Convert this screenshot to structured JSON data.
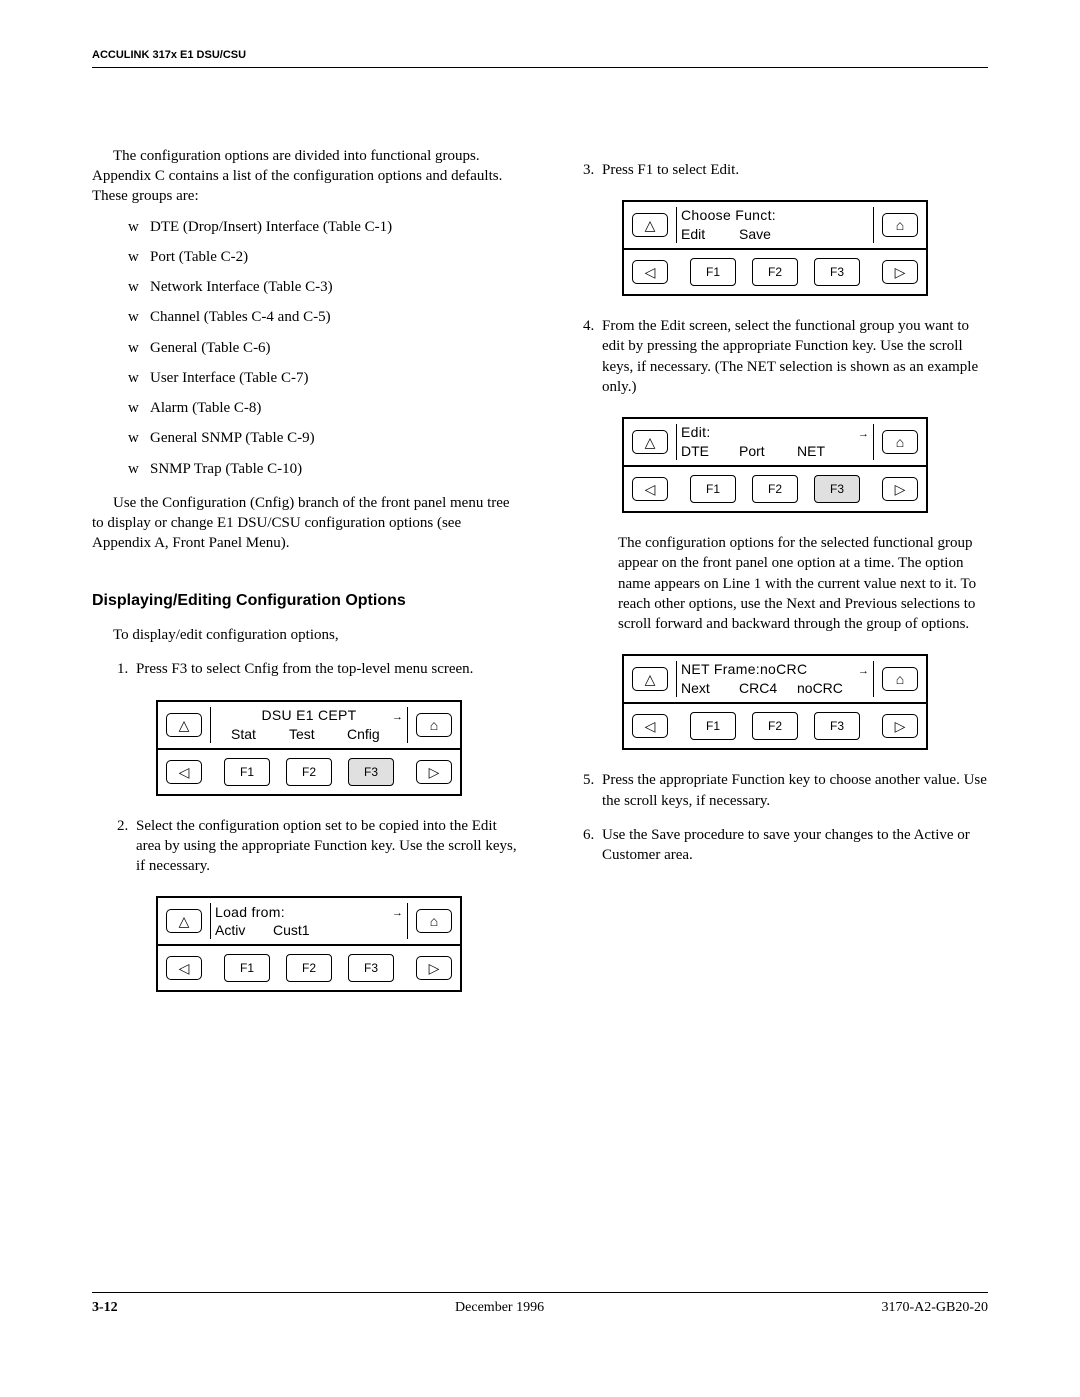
{
  "header": "ACCULINK 317x E1 DSU/CSU",
  "left": {
    "intro": "The configuration options are divided into functional groups. Appendix C contains a list of the configuration options and defaults. These groups are:",
    "groups": [
      "DTE (Drop/Insert) Interface (Table C-1)",
      "Port (Table C-2)",
      "Network Interface (Table C-3)",
      "Channel (Tables C-4 and C-5)",
      "General (Table C-6)",
      "User Interface (Table C-7)",
      "Alarm (Table C-8)",
      "General SNMP (Table C-9)",
      "SNMP Trap (Table C-10)"
    ],
    "use_cfg": "Use the Configuration (Cnfig) branch of the front panel menu tree to display or change E1 DSU/CSU configuration options (see Appendix A, Front Panel Menu).",
    "section_title": "Displaying/Editing Configuration Options",
    "to_display": "To display/edit configuration options,",
    "step1": "Press F3 to select Cnfig from the top-level menu screen.",
    "panel1": {
      "line1": "DSU E1 CEPT",
      "soft": [
        "Stat",
        "Test",
        "Cnfig"
      ],
      "fns": [
        "F1",
        "F2",
        "F3"
      ],
      "active": 2
    },
    "step2": "Select the configuration option set to be copied into the Edit area by using the appropriate Function key. Use the scroll keys, if necessary.",
    "panel2": {
      "line1": "Load from:",
      "soft": [
        "Activ",
        "Cust1"
      ],
      "fns": [
        "F1",
        "F2",
        "F3"
      ],
      "active": -1
    }
  },
  "right": {
    "step3": "Press F1 to select Edit.",
    "panel3": {
      "line1": "Choose Funct:",
      "soft": [
        "Edit",
        "Save"
      ],
      "fns": [
        "F1",
        "F2",
        "F3"
      ],
      "active": -1
    },
    "step4": "From the Edit screen, select the functional group you want to edit by pressing the appropriate Function key. Use the scroll keys, if necessary. (The NET selection is shown as an example only.)",
    "panel4": {
      "line1": "Edit:",
      "soft": [
        "DTE",
        "Port",
        "NET"
      ],
      "fns": [
        "F1",
        "F2",
        "F3"
      ],
      "active": 2
    },
    "after4": "The configuration options for the selected functional group appear on the front panel one option at a time. The option name appears on Line 1 with the current value next to it. To reach other options, use the Next and Previous selections to scroll forward and backward through the group of options.",
    "panel5": {
      "line1": "NET Frame:noCRC",
      "soft": [
        "Next",
        "CRC4",
        "noCRC"
      ],
      "fns": [
        "F1",
        "F2",
        "F3"
      ],
      "active": -1,
      "noLcdBorder": true
    },
    "step5": "Press the appropriate Function key to choose another value. Use the scroll keys, if necessary.",
    "step6": "Use the Save procedure to save your changes to the Active or Customer area."
  },
  "symbols": {
    "up": "△",
    "down_hat": "⌂",
    "left": "◁",
    "right": "▷",
    "arrow": "→"
  },
  "footer": {
    "page": "3-12",
    "date": "December 1996",
    "doc": "3170-A2-GB20-20"
  }
}
